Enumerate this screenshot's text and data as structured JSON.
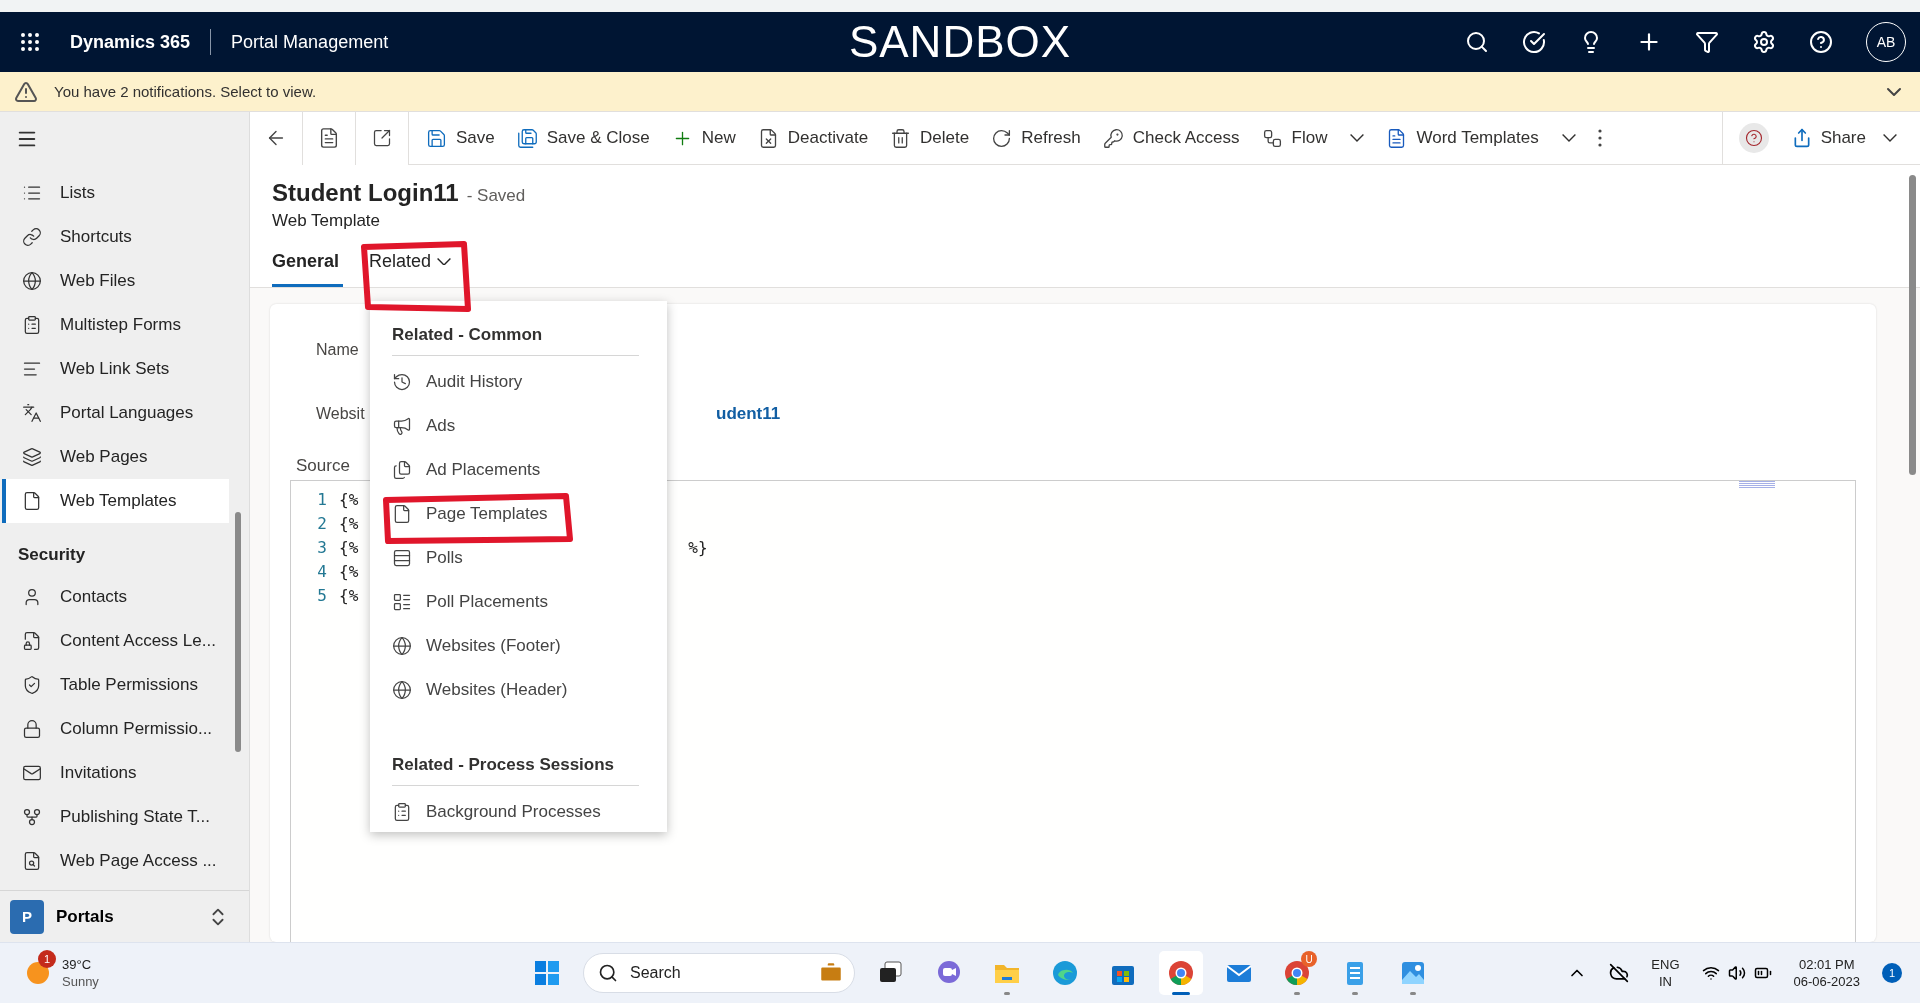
{
  "header": {
    "app_name": "Dynamics 365",
    "area": "Portal Management",
    "environment": "SANDBOX",
    "avatar": "AB"
  },
  "notification": {
    "text": "You have 2 notifications. Select to view."
  },
  "command_bar": {
    "items": [
      {
        "label": "Save",
        "kind": "button"
      },
      {
        "label": "Save & Close",
        "kind": "button"
      },
      {
        "label": "New",
        "kind": "button"
      },
      {
        "label": "Deactivate",
        "kind": "button"
      },
      {
        "label": "Delete",
        "kind": "button"
      },
      {
        "label": "Refresh",
        "kind": "button"
      },
      {
        "label": "Check Access",
        "kind": "button"
      },
      {
        "label": "Flow",
        "kind": "dropdown"
      },
      {
        "label": "Word Templates",
        "kind": "dropdown"
      }
    ],
    "share": "Share"
  },
  "sidebar": {
    "groups": [
      {
        "items": [
          {
            "label": "Lists",
            "selected": false
          },
          {
            "label": "Shortcuts",
            "selected": false
          },
          {
            "label": "Web Files",
            "selected": false
          },
          {
            "label": "Multistep Forms",
            "selected": false
          },
          {
            "label": "Web Link Sets",
            "selected": false
          },
          {
            "label": "Portal Languages",
            "selected": false
          },
          {
            "label": "Web Pages",
            "selected": false
          },
          {
            "label": "Web Templates",
            "selected": true
          }
        ]
      },
      {
        "title": "Security",
        "items": [
          {
            "label": "Contacts",
            "selected": false
          },
          {
            "label": "Content Access Le...",
            "selected": false
          },
          {
            "label": "Table Permissions",
            "selected": false
          },
          {
            "label": "Column Permissio...",
            "selected": false
          },
          {
            "label": "Invitations",
            "selected": false
          },
          {
            "label": "Publishing State T...",
            "selected": false
          },
          {
            "label": "Web Page Access ...",
            "selected": false
          }
        ]
      }
    ],
    "area_switcher": {
      "badge": "P",
      "label": "Portals"
    }
  },
  "record": {
    "title": "Student Login11",
    "status": "- Saved",
    "entity": "Web Template"
  },
  "tabs": [
    {
      "label": "General",
      "selected": true,
      "kind": "tab"
    },
    {
      "label": "Related",
      "selected": false,
      "kind": "dropdown"
    }
  ],
  "form": {
    "fields": [
      {
        "label": "Name"
      },
      {
        "label": "Websit",
        "value": "udent11"
      }
    ],
    "source_label": "Source",
    "code_lines": [
      {
        "number": "1",
        "text": "{%"
      },
      {
        "number": "2",
        "text": "{%"
      },
      {
        "number": "3",
        "text": "{%",
        "tail": "%}"
      },
      {
        "number": "4",
        "text": "{%"
      },
      {
        "number": "5",
        "text": "{%"
      }
    ]
  },
  "related_menu": {
    "sections": [
      {
        "title": "Related - Common",
        "items": [
          "Audit History",
          "Ads",
          "Ad Placements",
          "Page Templates",
          "Polls",
          "Poll Placements",
          "Websites (Footer)",
          "Websites (Header)"
        ]
      },
      {
        "title": "Related - Process Sessions",
        "items": [
          "Background Processes"
        ]
      }
    ]
  },
  "taskbar": {
    "weather": {
      "badge": "1",
      "temperature": "39°C",
      "condition": "Sunny"
    },
    "search": "Search",
    "apps": [
      {
        "running": false,
        "selected": false
      },
      {
        "running": false,
        "selected": false
      },
      {
        "running": false,
        "selected": false
      },
      {
        "running": true,
        "selected": false
      },
      {
        "running": false,
        "selected": false
      },
      {
        "running": false,
        "selected": false
      },
      {
        "running": true,
        "selected": true
      },
      {
        "running": false,
        "selected": false
      },
      {
        "running": true,
        "selected": false,
        "badge": "U"
      },
      {
        "running": true,
        "selected": false
      },
      {
        "running": true,
        "selected": false
      }
    ],
    "language": "ENG",
    "region": "IN",
    "time": "02:01 PM",
    "date": "06-06-2023",
    "notification_count": "1"
  }
}
